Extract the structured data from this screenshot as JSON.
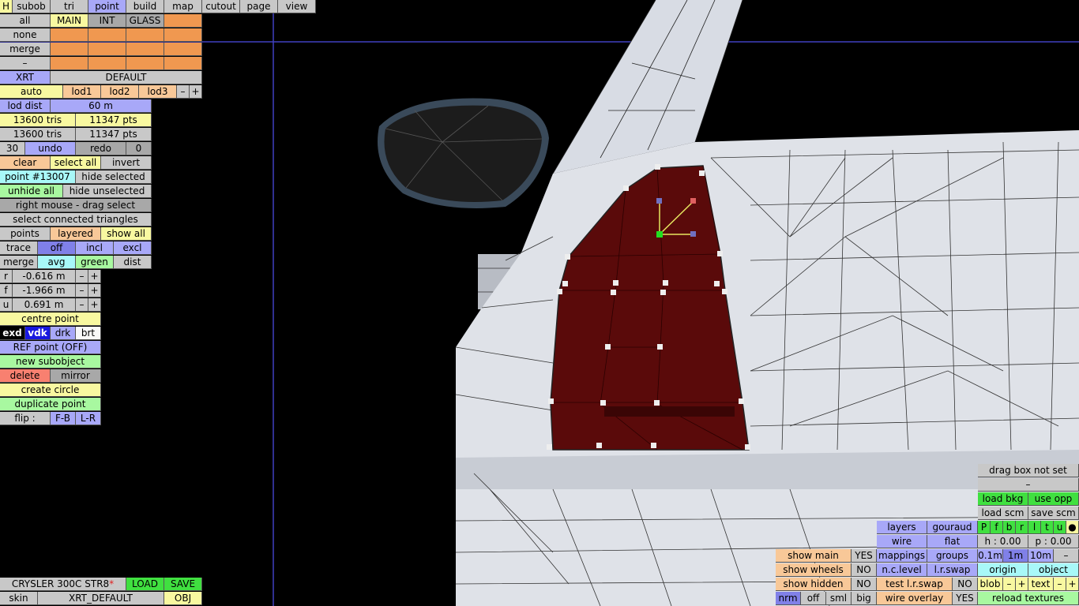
{
  "top": {
    "h": "H",
    "tabs": [
      "subob",
      "tri",
      "point",
      "build",
      "map",
      "cutout",
      "page",
      "view"
    ]
  },
  "groups": {
    "all": "all",
    "main": "MAIN",
    "int": "INT",
    "glass": "GLASS",
    "none": "none",
    "merge": "merge",
    "dash": "–"
  },
  "lod": {
    "xrt": "XRT",
    "default": "DEFAULT",
    "auto": "auto",
    "l1": "lod1",
    "l2": "lod2",
    "l3": "lod3",
    "minus": "–",
    "plus": "+",
    "dist_label": "lod dist",
    "dist_value": "60 m"
  },
  "stats": {
    "tris1": "13600 tris",
    "pts1": "11347 pts",
    "tris2": "13600 tris",
    "pts2": "11347 pts"
  },
  "undo": {
    "count": "30",
    "undo": "undo",
    "redo": "redo",
    "zero": "0"
  },
  "sel": {
    "clear": "clear",
    "select_all": "select all",
    "invert": "invert",
    "point": "point #13007",
    "hide_selected": "hide selected",
    "unhide_all": "unhide all",
    "hide_unselected": "hide unselected",
    "right_mouse": "right mouse - drag select",
    "select_connected": "select connected triangles",
    "points": "points",
    "layered": "layered",
    "show_all": "show all"
  },
  "trace": {
    "trace": "trace",
    "off": "off",
    "incl": "incl",
    "excl": "excl",
    "merge": "merge",
    "avg": "avg",
    "green": "green",
    "dist": "dist"
  },
  "coords": {
    "r": "r",
    "r_val": "-0.616 m",
    "f": "f",
    "f_val": "-1.966 m",
    "u": "u",
    "u_val": "0.691 m",
    "minus": "–",
    "plus": "+"
  },
  "tools": {
    "centre": "centre point",
    "exd": "exd",
    "vdk": "vdk",
    "drk": "drk",
    "brt": "brt",
    "ref": "REF point (OFF)",
    "new_sub": "new subobject",
    "delete": "delete",
    "mirror": "mirror",
    "circle": "create circle",
    "duplicate": "duplicate point",
    "flip": "flip :",
    "fb": "F-B",
    "lr": "L-R"
  },
  "file": {
    "car": "CRYSLER 300C STR8",
    "star": "*",
    "load": "LOAD",
    "save": "SAVE",
    "skin": "skin",
    "xrt_default": "XRT_DEFAULT",
    "obj": "OBJ"
  },
  "bottom": {
    "show_main": "show main",
    "yes": "YES",
    "show_wheels": "show wheels",
    "no": "NO",
    "show_hidden": "show hidden",
    "no2": "NO",
    "nrm": "nrm",
    "off": "off",
    "sml": "sml",
    "big": "big",
    "layers": "layers",
    "gouraud": "gouraud",
    "wire": "wire",
    "flat": "flat",
    "mappings": "mappings",
    "groups": "groups",
    "nc_level": "n.c.level",
    "lr_swap": "l.r.swap",
    "test_lr": "test l.r.swap",
    "no3": "NO",
    "wire_overlay": "wire overlay",
    "yes2": "YES"
  },
  "right": {
    "drag_box": "drag box not set",
    "dash": "–",
    "load_bkg": "load bkg",
    "use_opp": "use opp",
    "load_scm": "load scm",
    "save_scm": "save scm",
    "views": [
      "P",
      "f",
      "b",
      "r",
      "l",
      "t",
      "u"
    ],
    "dot": "●",
    "h": "h : 0.00",
    "p": "p : 0.00",
    "s1": "0.1m",
    "s2": "1m",
    "s3": "10m",
    "sm": "–",
    "origin": "origin",
    "object": "object",
    "blob": "blob",
    "text": "text",
    "reload": "reload textures",
    "minus": "–",
    "plus": "+"
  }
}
